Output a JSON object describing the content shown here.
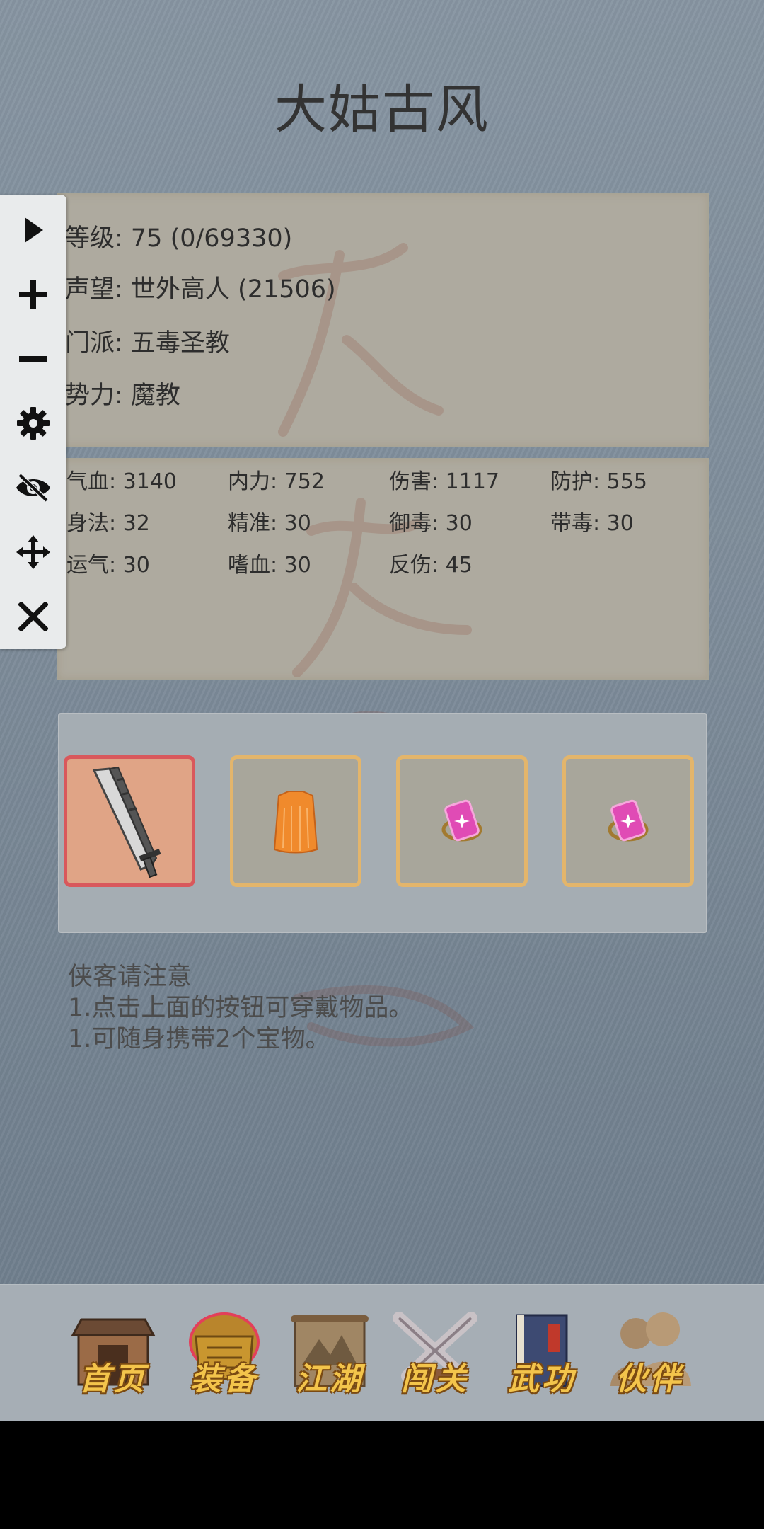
{
  "header": {
    "title": "大姑古风"
  },
  "info": {
    "level": "等级: 75 (0/69330)",
    "prestige": "声望: 世外高人 (21506)",
    "sect": "门派: 五毒圣教",
    "faction": "势力:  魔教"
  },
  "stats": [
    [
      "气血: 3140",
      "内力: 752",
      "伤害: 1117",
      "防护: 555"
    ],
    [
      "身法: 32",
      "精准: 30",
      "御毒: 30",
      "带毒: 30"
    ],
    [
      "运气: 30",
      "嗜血: 30",
      "反伤: 45"
    ]
  ],
  "toolbar": {
    "icons": [
      "play-icon",
      "plus-icon",
      "minus-icon",
      "gear-icon",
      "eye-off-icon",
      "move-icon",
      "close-icon"
    ]
  },
  "equipment": {
    "slots": [
      "blade",
      "robe",
      "charm",
      "charm"
    ],
    "selected_index": 0
  },
  "notes": {
    "heading": "侠客请注意",
    "line1": "1.点击上面的按钮可穿戴物品。",
    "line2": "1.可随身携带2个宝物。"
  },
  "nav": {
    "items": [
      "首页",
      "装备",
      "江湖",
      "闯关",
      "武功",
      "伙伴"
    ],
    "active_index": 1
  },
  "colors": {
    "gold_label": "#f3c44b",
    "active_slot_border": "#d9585c",
    "slot_border": "#e3b56b"
  }
}
